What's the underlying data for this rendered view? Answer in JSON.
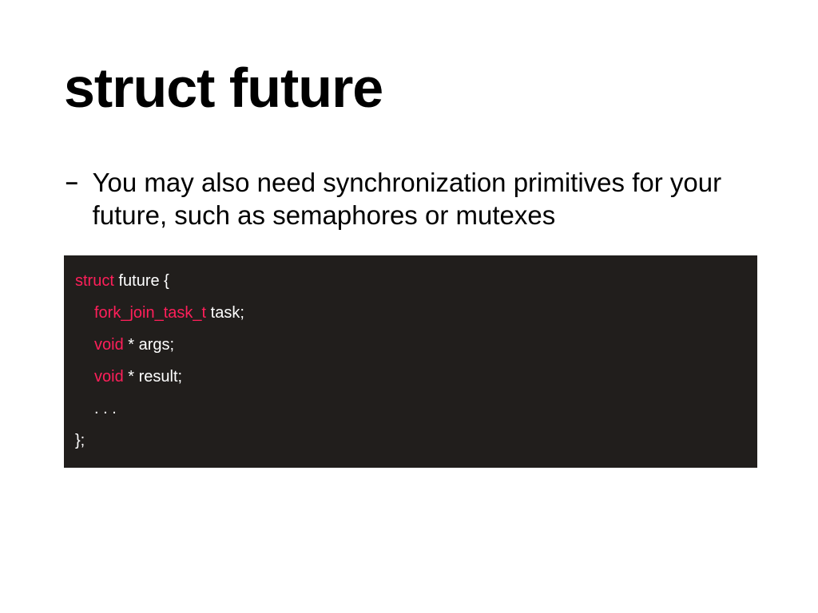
{
  "title": "struct future",
  "bullet": {
    "dash": "–",
    "text": "You may also need synchronization primitives for your future, such as semaphores or mutexes"
  },
  "code": {
    "line1_kw": "struct",
    "line1_rest": " future {",
    "line2_kw": "fork_join_task_t",
    "line2_rest": " task;",
    "line3_kw": "void",
    "line3_rest": " * args;",
    "line4_kw": "void",
    "line4_rest": " * result;",
    "line5": ". . .",
    "line6": "};"
  }
}
